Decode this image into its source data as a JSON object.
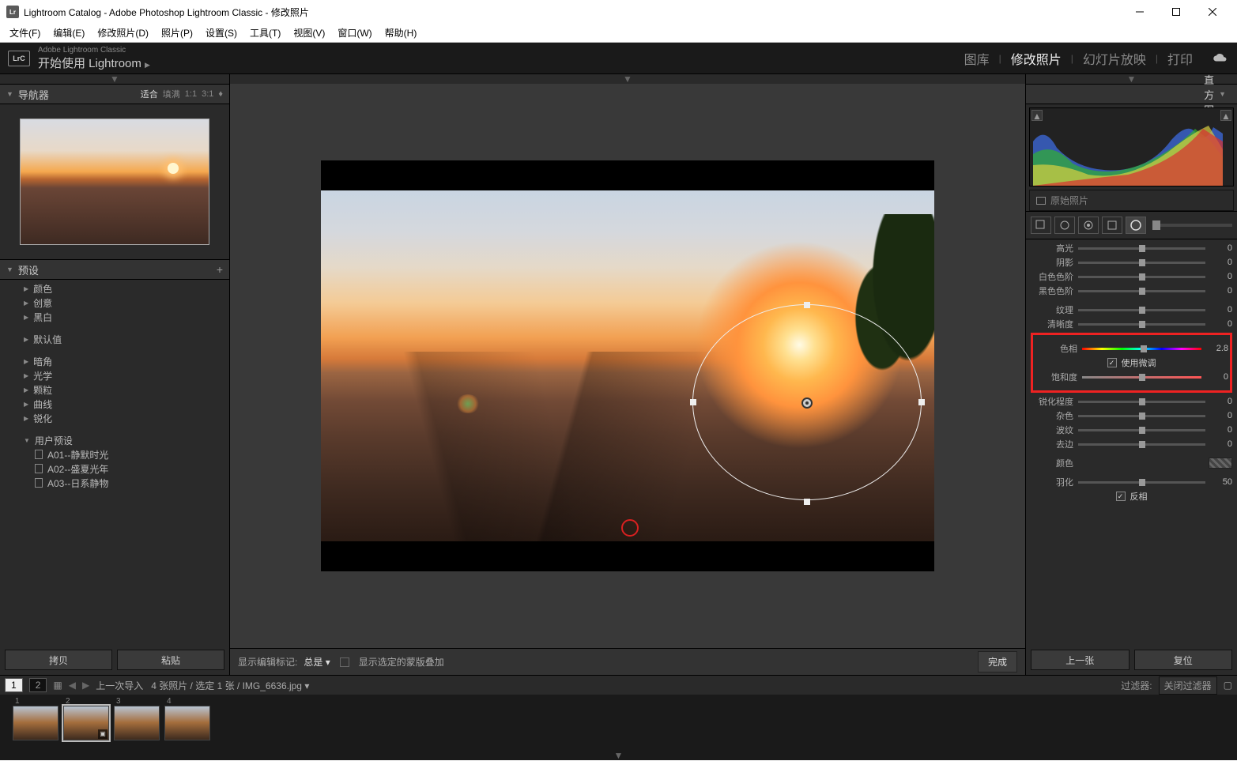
{
  "window": {
    "title": "Lightroom Catalog - Adobe Photoshop Lightroom Classic - 修改照片"
  },
  "menubar": [
    "文件(F)",
    "编辑(E)",
    "修改照片(D)",
    "照片(P)",
    "设置(S)",
    "工具(T)",
    "视图(V)",
    "窗口(W)",
    "帮助(H)"
  ],
  "topbar": {
    "suite": "Adobe Lightroom Classic",
    "product": "开始使用 Lightroom",
    "modules": [
      "图库",
      "修改照片",
      "幻灯片放映",
      "打印"
    ],
    "active_module": "修改照片"
  },
  "left": {
    "navigator": {
      "title": "导航器",
      "opts": [
        "适合",
        "填满",
        "1:1",
        "3:1"
      ]
    },
    "presets": {
      "title": "预设",
      "groups": [
        "颜色",
        "创意",
        "黑白"
      ],
      "groups2": [
        "默认值"
      ],
      "groups3": [
        "暗角",
        "光学",
        "颗粒",
        "曲线",
        "锐化"
      ],
      "user": {
        "title": "用户预设",
        "items": [
          "A01--静默时光",
          "A02--盛夏光年",
          "A03--日系静物"
        ]
      }
    },
    "copy": "拷贝",
    "paste": "粘贴"
  },
  "center": {
    "show_edit_label": "显示编辑标记:",
    "show_edit_value": "总是",
    "mask_overlay_label": "显示选定的蒙版叠加",
    "done": "完成"
  },
  "right": {
    "histogram_title": "直方图",
    "original_photo": "原始照片",
    "sliders": {
      "highlights": {
        "label": "高光",
        "value": "0"
      },
      "shadows": {
        "label": "阴影",
        "value": "0"
      },
      "whites": {
        "label": "白色色阶",
        "value": "0"
      },
      "blacks": {
        "label": "黑色色阶",
        "value": "0"
      },
      "texture": {
        "label": "纹理",
        "value": "0"
      },
      "clarity": {
        "label": "清晰度",
        "value": "0"
      },
      "hue": {
        "label": "色相",
        "value": "2.8"
      },
      "fine_tune": {
        "label": "使用微调"
      },
      "saturation": {
        "label": "饱和度",
        "value": "0"
      },
      "sharpness": {
        "label": "锐化程度",
        "value": "0"
      },
      "noise": {
        "label": "杂色",
        "value": "0"
      },
      "moire": {
        "label": "波纹",
        "value": "0"
      },
      "defringe": {
        "label": "去边",
        "value": "0"
      },
      "color": {
        "label": "颜色"
      },
      "feather": {
        "label": "羽化",
        "value": "50"
      },
      "invert": {
        "label": "反相"
      }
    },
    "prev": "上一张",
    "reset": "复位"
  },
  "filmstrip": {
    "one": "1",
    "two": "2",
    "last_import": "上一次导入",
    "count": "4 张照片 / 选定 1 张",
    "filename": "IMG_6636.jpg",
    "filter_label": "过滤器:",
    "close_filter": "关闭过滤器",
    "thumbs": [
      "1",
      "2",
      "3",
      "4"
    ]
  }
}
